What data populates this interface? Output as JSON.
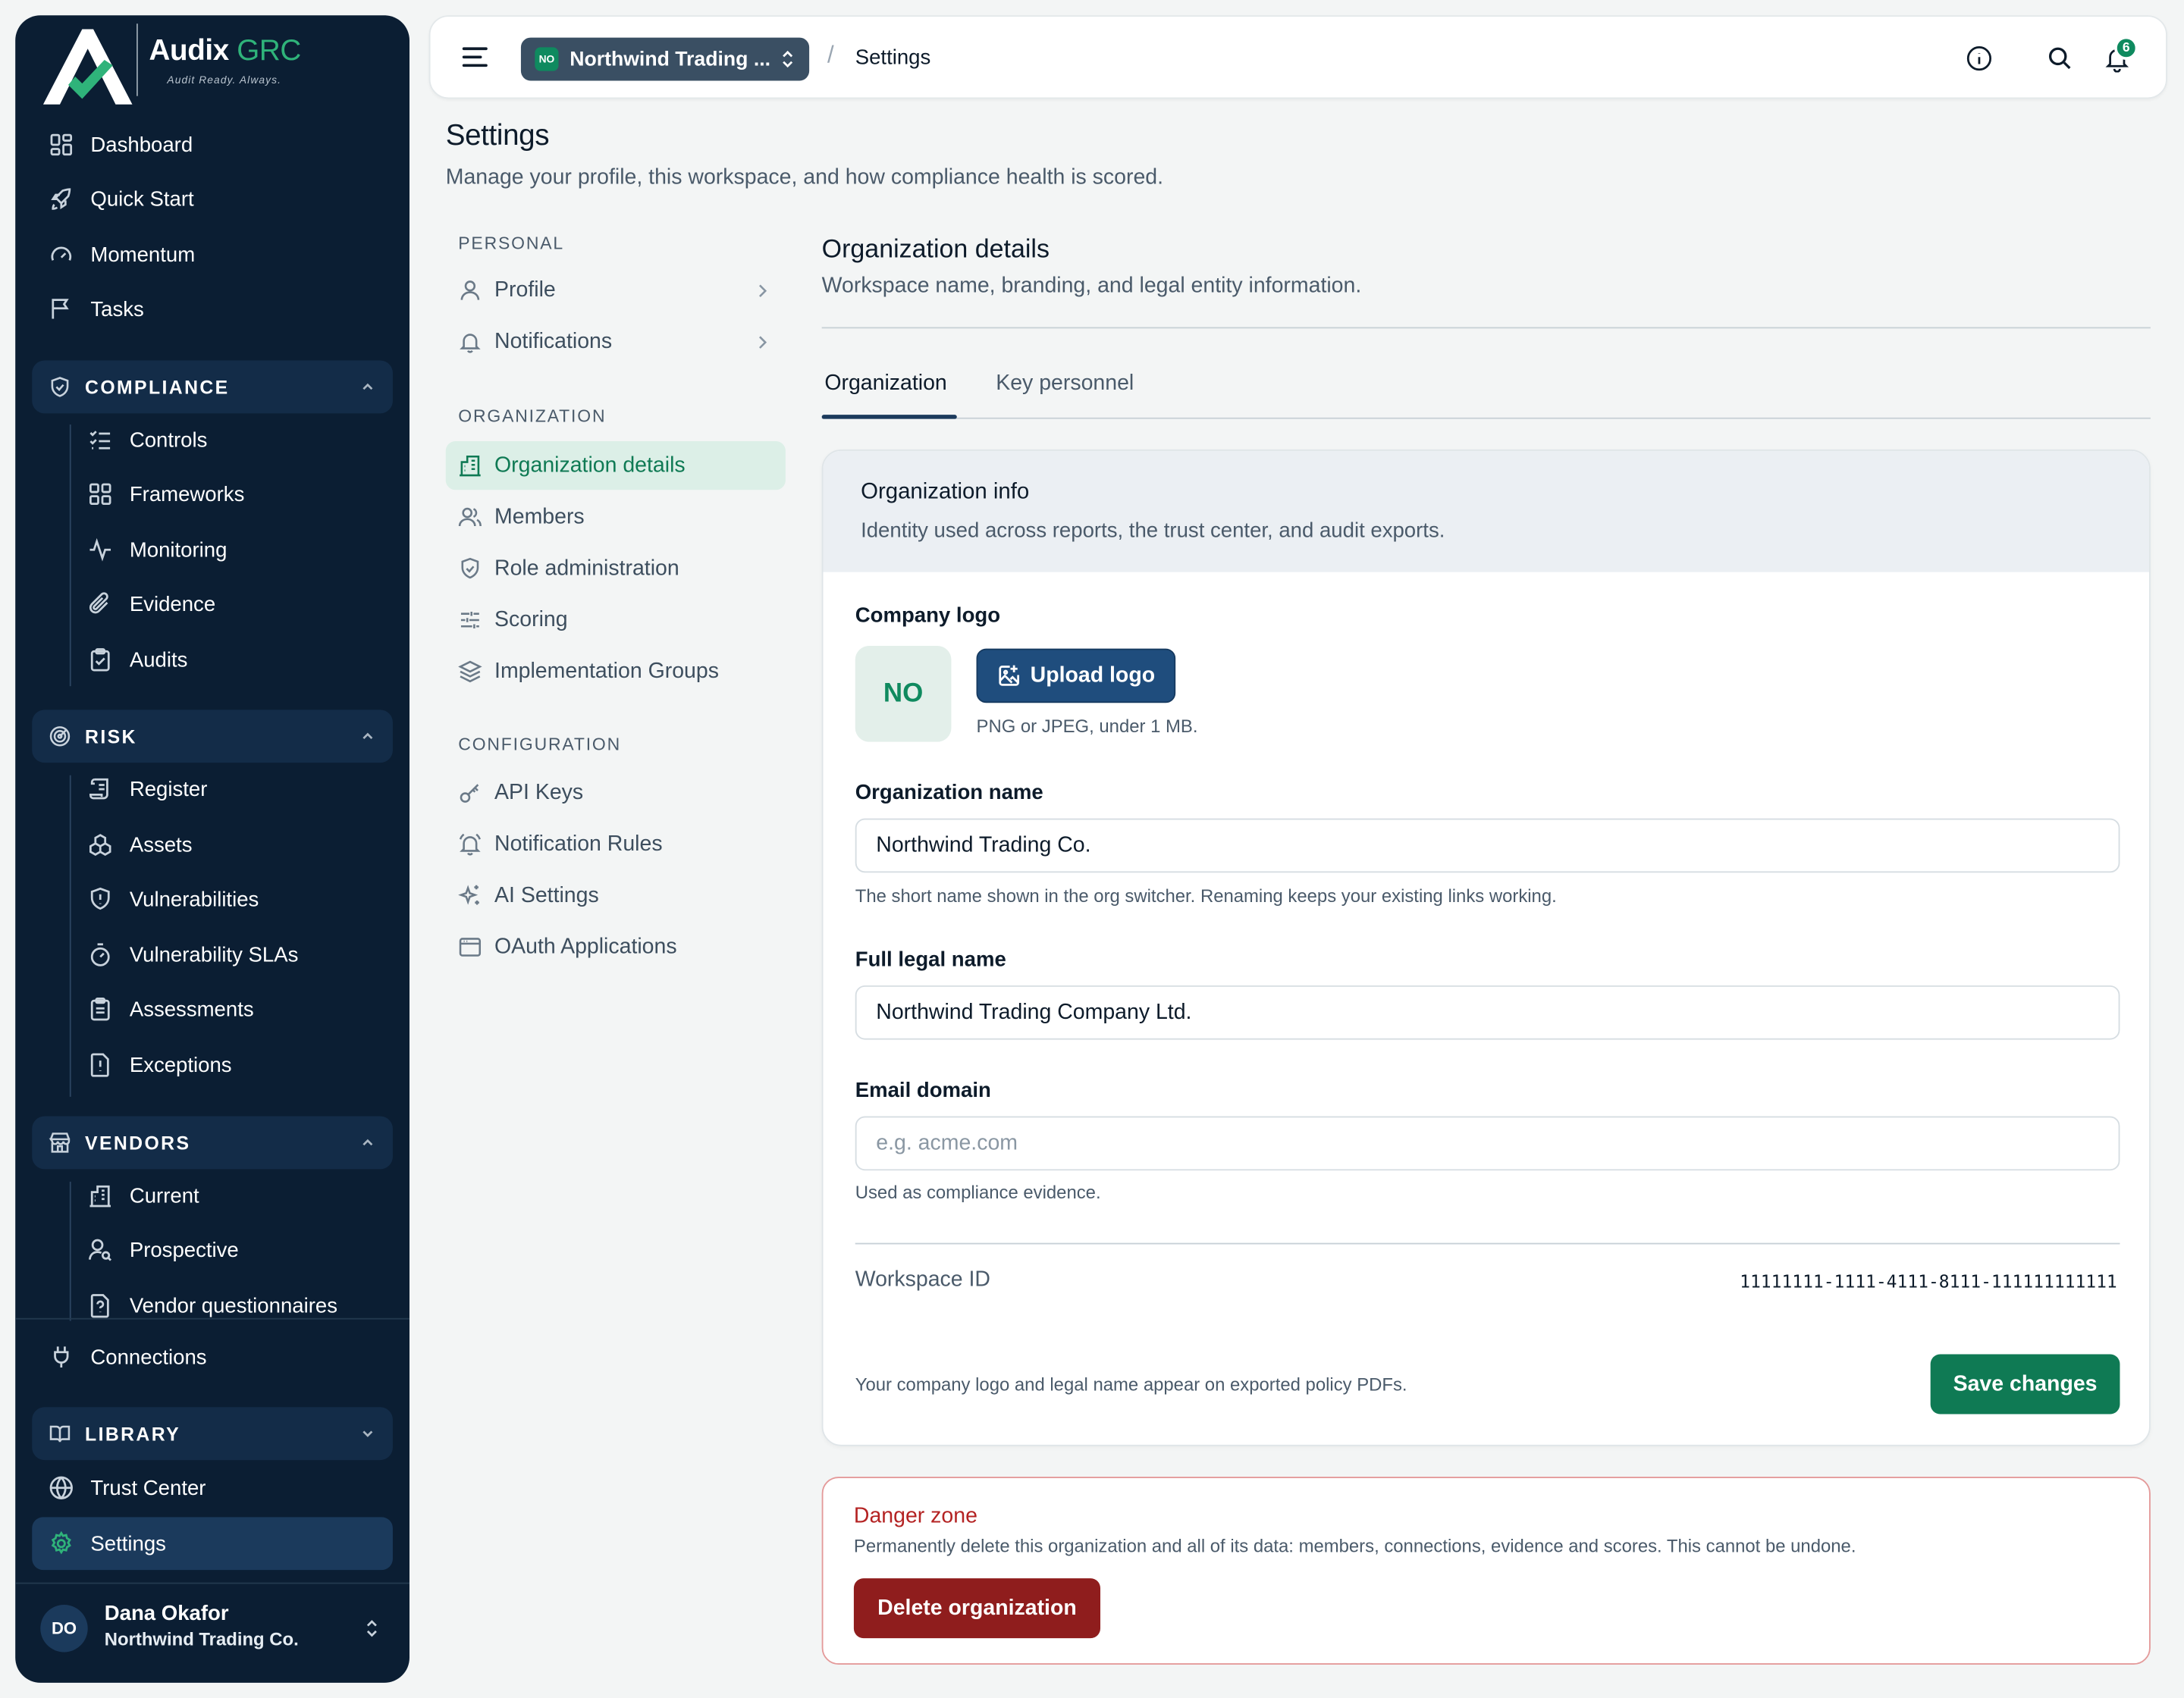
{
  "brand": {
    "name": "Audix",
    "name_accent": "GRC",
    "tagline": "Audit Ready. Always."
  },
  "sidebar": {
    "top_items": [
      {
        "label": "Dashboard",
        "icon": "dashboard-icon"
      },
      {
        "label": "Quick Start",
        "icon": "rocket-icon"
      },
      {
        "label": "Momentum",
        "icon": "gauge-icon"
      },
      {
        "label": "Tasks",
        "icon": "flag-icon"
      }
    ],
    "compliance": {
      "label": "COMPLIANCE",
      "items": [
        {
          "label": "Controls",
          "icon": "list-checks-icon"
        },
        {
          "label": "Frameworks",
          "icon": "grid-icon"
        },
        {
          "label": "Monitoring",
          "icon": "activity-icon"
        },
        {
          "label": "Evidence",
          "icon": "paperclip-icon"
        },
        {
          "label": "Audits",
          "icon": "clipboard-check-icon"
        }
      ]
    },
    "risk": {
      "label": "RISK",
      "items": [
        {
          "label": "Register",
          "icon": "scroll-icon"
        },
        {
          "label": "Assets",
          "icon": "boxes-icon"
        },
        {
          "label": "Vulnerabilities",
          "icon": "shield-alert-icon"
        },
        {
          "label": "Vulnerability SLAs",
          "icon": "timer-icon"
        },
        {
          "label": "Assessments",
          "icon": "clipboard-list-icon"
        },
        {
          "label": "Exceptions",
          "icon": "file-warning-icon"
        }
      ]
    },
    "vendors": {
      "label": "VENDORS",
      "items": [
        {
          "label": "Current",
          "icon": "building-icon"
        },
        {
          "label": "Prospective",
          "icon": "user-search-icon"
        },
        {
          "label": "Vendor questionnaires",
          "icon": "file-question-icon"
        }
      ]
    },
    "connections": {
      "label": "Connections",
      "icon": "plug-icon"
    },
    "library": {
      "label": "LIBRARY"
    },
    "bottom_items": [
      {
        "label": "Trust Center",
        "icon": "globe-icon"
      },
      {
        "label": "Settings",
        "icon": "gear-icon"
      }
    ],
    "user": {
      "initials": "DO",
      "name": "Dana Okafor",
      "org": "Northwind Trading Co."
    }
  },
  "topbar": {
    "org_badge": "NO",
    "org_name": "Northwind Trading ...",
    "breadcrumb": "Settings",
    "notification_count": "6"
  },
  "page": {
    "title": "Settings",
    "subtitle": "Manage your profile, this workspace, and how compliance health is scored."
  },
  "settings_nav": {
    "personal_label": "PERSONAL",
    "personal": [
      {
        "label": "Profile"
      },
      {
        "label": "Notifications"
      }
    ],
    "organization_label": "ORGANIZATION",
    "organization": [
      {
        "label": "Organization details"
      },
      {
        "label": "Members"
      },
      {
        "label": "Role administration"
      },
      {
        "label": "Scoring"
      },
      {
        "label": "Implementation Groups"
      }
    ],
    "configuration_label": "CONFIGURATION",
    "configuration": [
      {
        "label": "API Keys"
      },
      {
        "label": "Notification Rules"
      },
      {
        "label": "AI Settings"
      },
      {
        "label": "OAuth Applications"
      }
    ]
  },
  "content": {
    "title": "Organization details",
    "subtitle": "Workspace name, branding, and legal entity information.",
    "tabs": [
      {
        "label": "Organization"
      },
      {
        "label": "Key personnel"
      }
    ]
  },
  "card": {
    "title": "Organization info",
    "subtitle": "Identity used across reports, the trust center, and audit exports.",
    "logo_label": "Company logo",
    "logo_initials": "NO",
    "upload_label": "Upload logo",
    "upload_hint": "PNG or JPEG, under 1 MB.",
    "org_name_label": "Organization name",
    "org_name_value": "Northwind Trading Co.",
    "org_name_hint": "The short name shown in the org switcher. Renaming keeps your existing links working.",
    "legal_name_label": "Full legal name",
    "legal_name_value": "Northwind Trading Company Ltd.",
    "email_domain_label": "Email domain",
    "email_domain_value": "",
    "email_domain_placeholder": "e.g. acme.com",
    "email_domain_hint": "Used as compliance evidence.",
    "workspace_id_label": "Workspace ID",
    "workspace_id_value": "11111111-1111-4111-8111-111111111111",
    "footer_note": "Your company logo and legal name appear on exported policy PDFs.",
    "save_label": "Save changes"
  },
  "danger": {
    "title": "Danger zone",
    "text": "Permanently delete this organization and all of its data: members, connections, evidence and scores. This cannot be undone.",
    "button": "Delete organization"
  },
  "colors": {
    "sidebar_bg": "#0b1e33",
    "accent_green": "#0f7a54",
    "primary_blue": "#1f4d7d",
    "danger_red": "#8f1d1d",
    "active_nav_bg": "#dcefe7"
  }
}
